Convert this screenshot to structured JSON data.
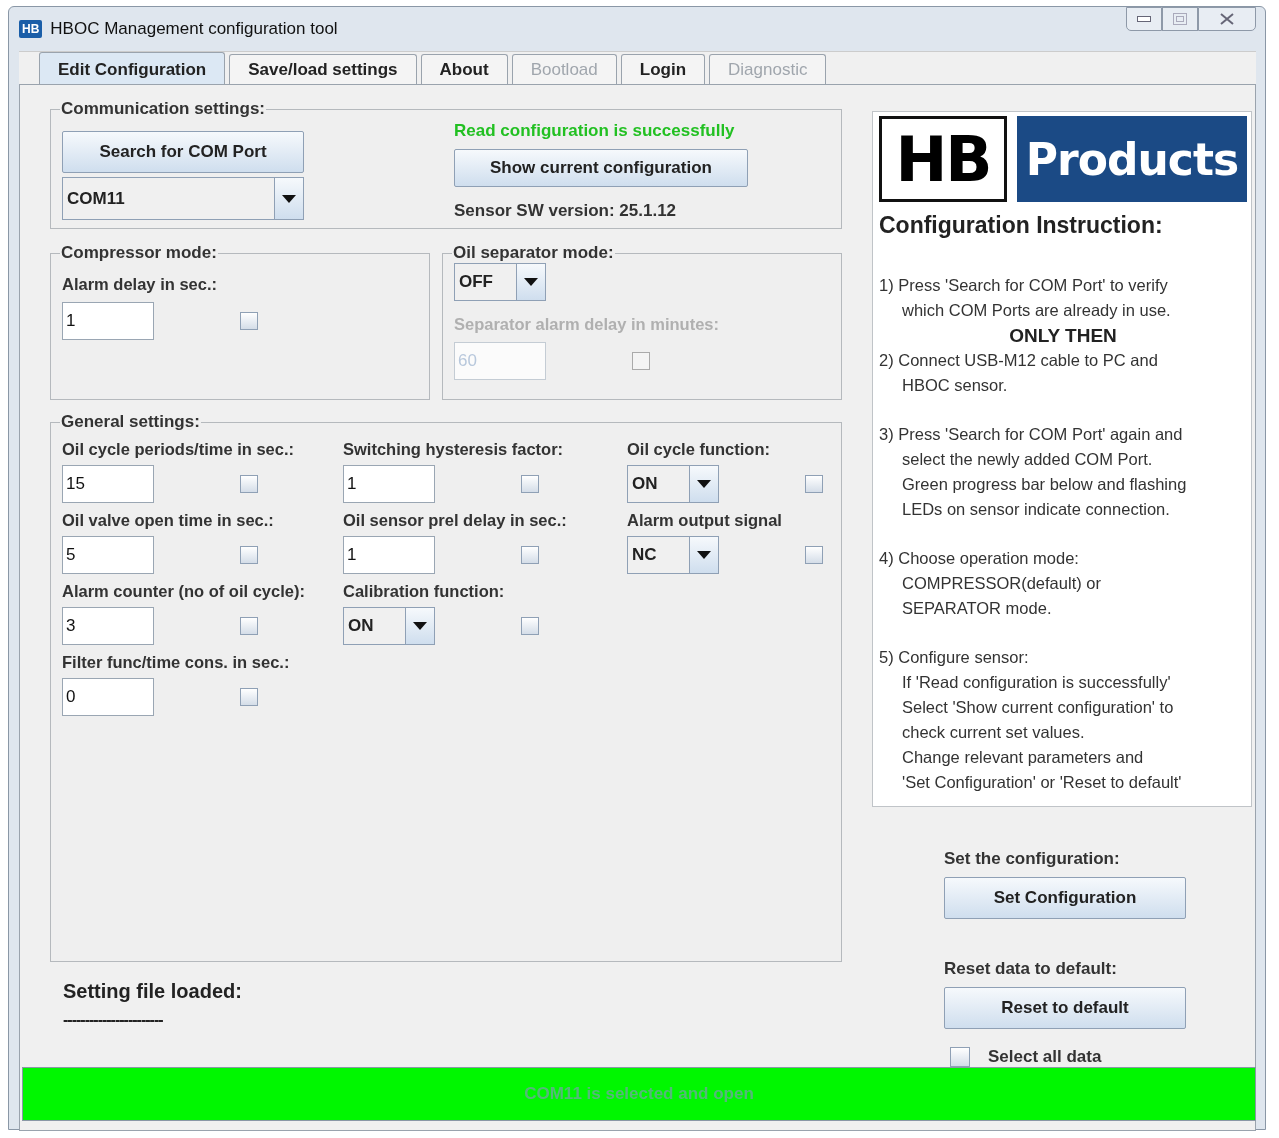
{
  "window": {
    "icon_text": "HB",
    "title": "HBOC Management configuration tool"
  },
  "tabs": [
    {
      "label": "Edit Configuration",
      "selected": true,
      "disabled": false
    },
    {
      "label": "Save/load settings",
      "selected": false,
      "disabled": false
    },
    {
      "label": "About",
      "selected": false,
      "disabled": false
    },
    {
      "label": "Bootload",
      "selected": false,
      "disabled": true
    },
    {
      "label": "Login",
      "selected": false,
      "disabled": false
    },
    {
      "label": "Diagnostic",
      "selected": false,
      "disabled": true
    }
  ],
  "communication": {
    "title": "Communication settings:",
    "search_button": "Search for COM Port",
    "port": "COM11",
    "status": "Read configuration is successfully",
    "show_button": "Show current configuration",
    "version": "Sensor SW version: 25.1.12"
  },
  "compressor": {
    "title": "Compressor mode:",
    "fields": [
      {
        "label": "Alarm delay in sec.:",
        "kind": "input",
        "value": "1",
        "checked": false,
        "disabled": false
      }
    ]
  },
  "separator": {
    "title": "Oil separator mode:",
    "mode": "OFF",
    "fields": [
      {
        "label": "Separator alarm delay in minutes:",
        "kind": "input",
        "value": "60",
        "checked": false,
        "disabled": true
      }
    ]
  },
  "general": {
    "title": "General settings:",
    "columns": [
      [
        {
          "label": "Oil cycle periods/time in sec.:",
          "kind": "input",
          "value": "15",
          "checked": false,
          "disabled": false
        },
        {
          "label": "Oil valve open time in sec.:",
          "kind": "input",
          "value": "5",
          "checked": false,
          "disabled": false
        },
        {
          "label": "Alarm counter (no of oil cycle):",
          "kind": "input",
          "value": "3",
          "checked": false,
          "disabled": false
        },
        {
          "label": "Filter func/time cons. in sec.:",
          "kind": "input",
          "value": "0",
          "checked": false,
          "disabled": false
        }
      ],
      [
        {
          "label": "Switching hysteresis factor:",
          "kind": "input",
          "value": "1",
          "checked": false,
          "disabled": false
        },
        {
          "label": "Oil sensor prel delay in sec.:",
          "kind": "input",
          "value": "1",
          "checked": false,
          "disabled": false
        },
        {
          "label": "Calibration function:",
          "kind": "dropdown",
          "value": "ON",
          "checked": false,
          "disabled": false
        }
      ],
      [
        {
          "label": "Oil cycle function:",
          "kind": "dropdown",
          "value": "ON",
          "checked": false,
          "disabled": false
        },
        {
          "label": "Alarm output signal",
          "kind": "dropdown",
          "value": "NC",
          "checked": false,
          "disabled": false
        }
      ]
    ]
  },
  "setting_file": {
    "label": "Setting file loaded:",
    "value": "-----------------------"
  },
  "logo": {
    "left": "HB",
    "right": "Products"
  },
  "instructions": {
    "title": "Configuration Instruction:",
    "items": [
      {
        "kind": "step",
        "lines": [
          "1) Press 'Search for COM Port' to verify",
          "which COM Ports are already in use."
        ]
      },
      {
        "kind": "emphasis",
        "lines": [
          "ONLY THEN"
        ]
      },
      {
        "kind": "step",
        "lines": [
          "2) Connect USB-M12 cable to PC and",
          "HBOC sensor."
        ]
      },
      {
        "kind": "step",
        "lines": [
          "3) Press 'Search for COM Port' again and",
          "select the newly added COM Port.",
          "Green progress bar below and flashing",
          "LEDs on sensor indicate connection."
        ]
      },
      {
        "kind": "step",
        "lines": [
          "4) Choose operation mode:",
          "COMPRESSOR(default) or",
          "SEPARATOR mode."
        ]
      },
      {
        "kind": "step",
        "lines": [
          "5) Configure sensor:",
          "If 'Read configuration is successfully'",
          "Select 'Show current configuration' to",
          "check current set values.",
          "Change relevant parameters and",
          "'Set Configuration' or 'Reset to default'"
        ]
      }
    ]
  },
  "actions": {
    "set_label": "Set the configuration:",
    "set_button": "Set Configuration",
    "reset_label": "Reset data to default:",
    "reset_button": "Reset to default",
    "select_all": {
      "label": "Select all data",
      "checked": false
    }
  },
  "status_bar": {
    "text": "COM11 is selected and open",
    "level": 1
  }
}
